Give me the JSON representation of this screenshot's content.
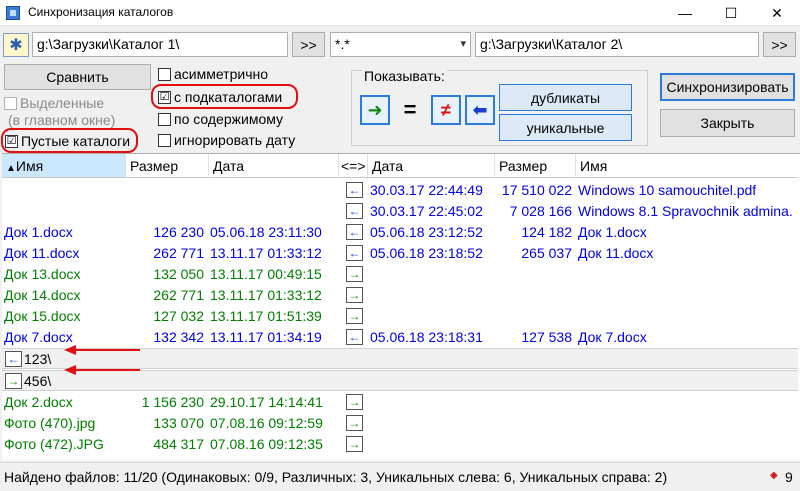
{
  "window": {
    "title": "Синхронизация каталогов",
    "minimize": "—",
    "maximize": "☐",
    "close": "✕"
  },
  "top": {
    "left_path": "g:\\Загрузки\\Каталог 1\\",
    "left_browse": ">>",
    "mask": "*.*",
    "right_path": "g:\\Загрузки\\Каталог 2\\",
    "right_browse": ">>"
  },
  "buttons": {
    "compare": "Сравнить",
    "sync": "Синхронизировать",
    "close": "Закрыть",
    "duplicates": "дубликаты",
    "unique": "уникальные"
  },
  "options": {
    "selected": "Выделенные",
    "selected_sub": "(в главном окне)",
    "empty_dirs": "Пустые каталоги",
    "asymmetric": "асимметрично",
    "subdirs": "с подкаталогами",
    "by_content": "по содержимому",
    "ignore_date": "игнорировать дату",
    "check": "☑",
    "uncheck": ""
  },
  "show": {
    "label": "Показывать:",
    "equal": "=",
    "not_equal": "≠"
  },
  "columns": {
    "left_name": "Имя",
    "left_size": "Размер",
    "left_date": "Дата",
    "compare": "<=>",
    "right_date": "Дата",
    "right_size": "Размер",
    "right_name": "Имя"
  },
  "rows": [
    {
      "ln": "",
      "ls": "",
      "ld": "",
      "dir": "←",
      "rd": "30.03.17 22:44:49",
      "rs": "17 510 022",
      "rn": "Windows 10 samouchitel.pdf",
      "color": "blue"
    },
    {
      "ln": "",
      "ls": "",
      "ld": "",
      "dir": "←",
      "rd": "30.03.17 22:45:02",
      "rs": "7 028 166",
      "rn": "Windows 8.1 Spravochnik admina.",
      "color": "blue"
    },
    {
      "ln": "Док 1.docx",
      "ls": "126 230",
      "ld": "05.06.18 23:11:30",
      "dir": "←",
      "rd": "05.06.18 23:12:52",
      "rs": "124 182",
      "rn": "Док 1.docx",
      "color": "blue"
    },
    {
      "ln": "Док 11.docx",
      "ls": "262 771",
      "ld": "13.11.17 01:33:12",
      "dir": "←",
      "rd": "05.06.18 23:18:52",
      "rs": "265 037",
      "rn": "Док 11.docx",
      "color": "blue"
    },
    {
      "ln": "Док 13.docx",
      "ls": "132 050",
      "ld": "13.11.17 00:49:15",
      "dir": "→",
      "rd": "",
      "rs": "",
      "rn": "",
      "color": "green"
    },
    {
      "ln": "Док 14.docx",
      "ls": "262 771",
      "ld": "13.11.17 01:33:12",
      "dir": "→",
      "rd": "",
      "rs": "",
      "rn": "",
      "color": "green"
    },
    {
      "ln": "Док 15.docx",
      "ls": "127 032",
      "ld": "13.11.17 01:51:39",
      "dir": "→",
      "rd": "",
      "rs": "",
      "rn": "",
      "color": "green"
    },
    {
      "ln": "Док 7.docx",
      "ls": "132 342",
      "ld": "13.11.17 01:34:19",
      "dir": "←",
      "rd": "05.06.18 23:18:31",
      "rs": "127 538",
      "rn": "Док 7.docx",
      "color": "blue"
    }
  ],
  "dir_rows": [
    {
      "name": "123\\",
      "dir": "←"
    },
    {
      "name": "456\\",
      "dir": "→"
    }
  ],
  "rows2": [
    {
      "ln": "Док 2.docx",
      "ls": "1 156 230",
      "ld": "29.10.17 14:14:41",
      "dir": "→",
      "color": "green"
    },
    {
      "ln": "Фото (470).jpg",
      "ls": "133 070",
      "ld": "07.08.16 09:12:59",
      "dir": "→",
      "color": "green"
    },
    {
      "ln": "Фото (472).JPG",
      "ls": "484 317",
      "ld": "07.08.16 09:12:35",
      "dir": "→",
      "color": "green"
    }
  ],
  "status": {
    "text": "Найдено файлов: 11/20  (Одинаковых: 0/9, Различных: 3, Уникальных слева: 6, Уникальных справа: 2)",
    "count": "9"
  },
  "colors": {
    "left_newer": "#008000",
    "right_newer": "#0000e0",
    "annotation": "#e01010",
    "header_active": "#cce8ff"
  }
}
